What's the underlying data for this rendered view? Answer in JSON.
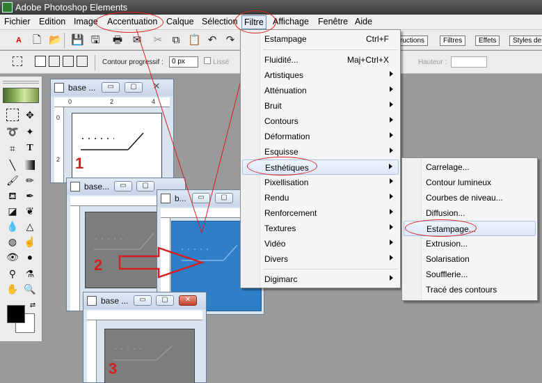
{
  "window": {
    "title": "Adobe Photoshop Elements"
  },
  "menubar": {
    "items": [
      "Fichier",
      "Edition",
      "Image",
      "Accentuation",
      "Calque",
      "Sélection",
      "Filtre",
      "Affichage",
      "Fenêtre",
      "Aide"
    ],
    "open_item": "Filtre"
  },
  "options_bar": {
    "contour_label": "Contour progressif :",
    "contour_value": "0 px",
    "lisse_label": "Lissé",
    "hauteur_label": "Hauteur :"
  },
  "palette_tabs": [
    "ructions",
    "Filtres",
    "Effets",
    "Styles de"
  ],
  "filter_menu": [
    {
      "label": "Estampage",
      "shortcut": "Ctrl+F",
      "submenu": false
    },
    {
      "separator": true
    },
    {
      "label": "Fluidité...",
      "shortcut": "Maj+Ctrl+X",
      "submenu": false
    },
    {
      "label": "Artistiques",
      "submenu": true
    },
    {
      "label": "Atténuation",
      "submenu": true
    },
    {
      "label": "Bruit",
      "submenu": true
    },
    {
      "label": "Contours",
      "submenu": true
    },
    {
      "label": "Déformation",
      "submenu": true
    },
    {
      "label": "Esquisse",
      "submenu": true
    },
    {
      "label": "Esthétiques",
      "submenu": true,
      "highlighted": true
    },
    {
      "label": "Pixellisation",
      "submenu": true
    },
    {
      "label": "Rendu",
      "submenu": true
    },
    {
      "label": "Renforcement",
      "submenu": true
    },
    {
      "label": "Textures",
      "submenu": true
    },
    {
      "label": "Vidéo",
      "submenu": true
    },
    {
      "label": "Divers",
      "submenu": true
    },
    {
      "separator": true
    },
    {
      "label": "Digimarc",
      "submenu": true
    }
  ],
  "esthetiques_submenu": [
    {
      "label": "Carrelage..."
    },
    {
      "label": "Contour lumineux"
    },
    {
      "label": "Courbes de niveau..."
    },
    {
      "label": "Diffusion..."
    },
    {
      "label": "Estampage...",
      "highlighted": true
    },
    {
      "label": "Extrusion..."
    },
    {
      "label": "Solarisation"
    },
    {
      "label": "Soufflerie..."
    },
    {
      "label": "Tracé des contours"
    }
  ],
  "doc_windows": [
    {
      "name": "base ...",
      "step": "1"
    },
    {
      "name": "base...",
      "step": "2"
    },
    {
      "name": "b...",
      "step": ""
    },
    {
      "name": "base ...",
      "step": "3"
    }
  ],
  "ruler_labels": {
    "h1": "0",
    "h2": "2",
    "h3": "4",
    "v1": "0",
    "v2": "2"
  },
  "colors": {
    "highlight_ellipse": "#dd2222",
    "blue_canvas": "#2f7fc8",
    "grey_canvas": "#7d7d7d"
  }
}
